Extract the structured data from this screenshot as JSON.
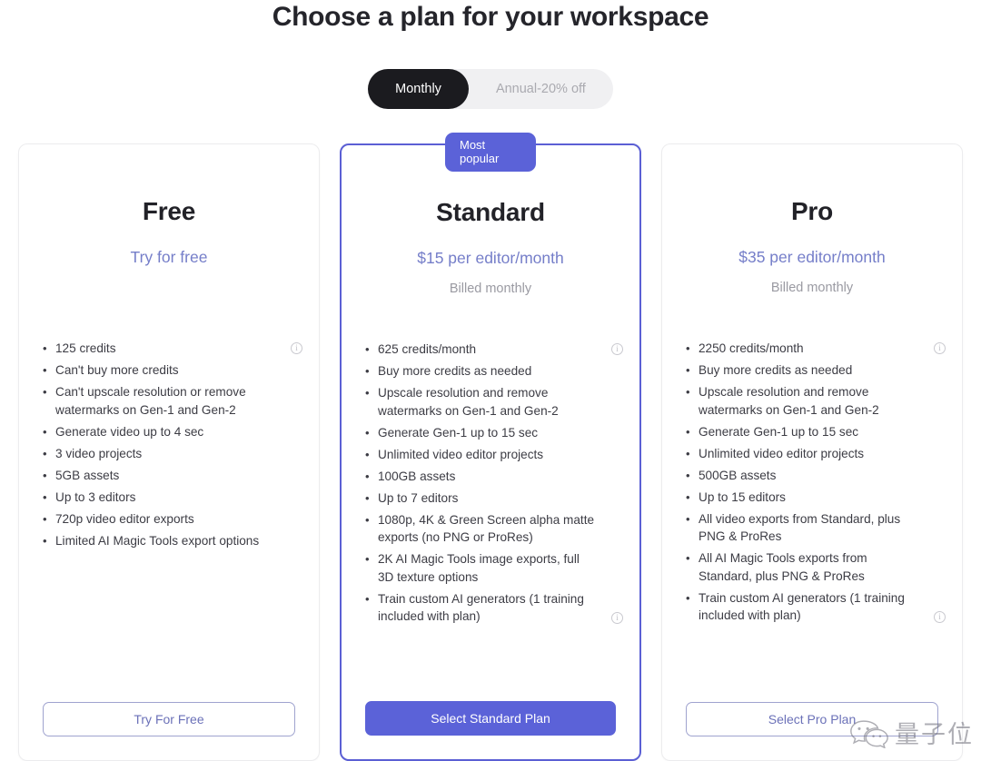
{
  "header": {
    "title": "Choose a plan for your workspace"
  },
  "billing_toggle": {
    "monthly_label": "Monthly",
    "annual_label": "Annual-20% off",
    "selected": "Monthly"
  },
  "badge": {
    "line1": "Most",
    "line2": "popular"
  },
  "colors": {
    "accent": "#5b62d8",
    "price_text": "#757ec9",
    "toggle_active_bg": "#1b1b1f",
    "card_border": "#ececee",
    "featured_border": "#5b5fd4"
  },
  "plans": [
    {
      "name": "Free",
      "price": "Try for free",
      "billing": "",
      "features": [
        {
          "text": "125 credits",
          "info": true
        },
        {
          "text": "Can't buy more credits",
          "info": false
        },
        {
          "text": "Can't upscale resolution or remove watermarks on Gen-1 and Gen-2",
          "info": false
        },
        {
          "text": "Generate video up to 4 sec",
          "info": false
        },
        {
          "text": "3 video projects",
          "info": false
        },
        {
          "text": "5GB assets",
          "info": false
        },
        {
          "text": "Up to 3 editors",
          "info": false
        },
        {
          "text": "720p video editor exports",
          "info": false
        },
        {
          "text": "Limited AI Magic Tools export options",
          "info": false
        }
      ],
      "cta_label": "Try For Free",
      "cta_style": "outline",
      "featured": false
    },
    {
      "name": "Standard",
      "price": "$15 per editor/month",
      "billing": "Billed monthly",
      "features": [
        {
          "text": "625 credits/month",
          "info": true
        },
        {
          "text": "Buy more credits as needed",
          "info": false
        },
        {
          "text": "Upscale resolution and remove watermarks on Gen-1 and Gen-2",
          "info": false
        },
        {
          "text": "Generate Gen-1 up to 15 sec",
          "info": false
        },
        {
          "text": "Unlimited video editor projects",
          "info": false
        },
        {
          "text": "100GB assets",
          "info": false
        },
        {
          "text": "Up to 7 editors",
          "info": false
        },
        {
          "text": "1080p, 4K & Green Screen alpha matte exports (no PNG or ProRes)",
          "info": false
        },
        {
          "text": "2K AI Magic Tools image exports, full 3D texture options",
          "info": false
        },
        {
          "text": "Train custom AI generators (1 training included with plan)",
          "info": true
        }
      ],
      "cta_label": "Select Standard Plan",
      "cta_style": "primary",
      "featured": true
    },
    {
      "name": "Pro",
      "price": "$35 per editor/month",
      "billing": "Billed monthly",
      "features": [
        {
          "text": "2250 credits/month",
          "info": true
        },
        {
          "text": "Buy more credits as needed",
          "info": false
        },
        {
          "text": "Upscale resolution and remove watermarks on Gen-1 and Gen-2",
          "info": false
        },
        {
          "text": "Generate Gen-1 up to 15 sec",
          "info": false
        },
        {
          "text": "Unlimited video editor projects",
          "info": false
        },
        {
          "text": "500GB assets",
          "info": false
        },
        {
          "text": "Up to 15 editors",
          "info": false
        },
        {
          "text": "All video exports from Standard, plus PNG & ProRes",
          "info": false
        },
        {
          "text": "All AI Magic Tools exports from Standard, plus PNG & ProRes",
          "info": false
        },
        {
          "text": "Train custom AI generators (1 training included with plan)",
          "info": true
        }
      ],
      "cta_label": "Select Pro Plan",
      "cta_style": "outline",
      "featured": false
    }
  ],
  "watermark": {
    "text": "量子位",
    "logo": "wechat-icon"
  }
}
